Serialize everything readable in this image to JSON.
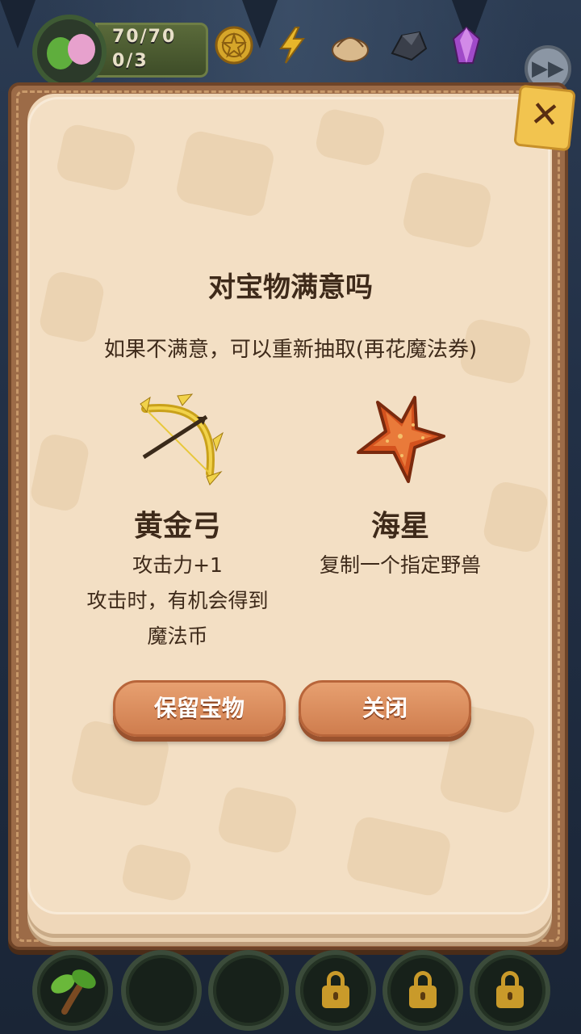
{
  "hud": {
    "hp": "70/70",
    "count": "0/3"
  },
  "resources": [
    "pentacle-coin-icon",
    "lightning-icon",
    "dumpling-icon",
    "ore-icon",
    "crystal-icon"
  ],
  "modal": {
    "title": "对宝物满意吗",
    "subtitle": "如果不满意，可以重新抽取(再花魔法券)",
    "items": [
      {
        "icon": "golden-bow-icon",
        "name": "黄金弓",
        "desc_line1": "攻击力+1",
        "desc_line2": "攻击时，有机会得到",
        "desc_line3": "魔法币"
      },
      {
        "icon": "starfish-icon",
        "name": "海星",
        "desc_line1": "复制一个指定野兽"
      }
    ],
    "keep_button": "保留宝物",
    "close_button": "关闭"
  },
  "slots": [
    "sprout-icon",
    "empty",
    "empty",
    "lock-icon",
    "lock-icon",
    "lock-icon"
  ],
  "colors": {
    "button": "#d8875a",
    "page": "#f3dfc4",
    "frame": "#9c6b47",
    "close_tab": "#f2c44f"
  }
}
